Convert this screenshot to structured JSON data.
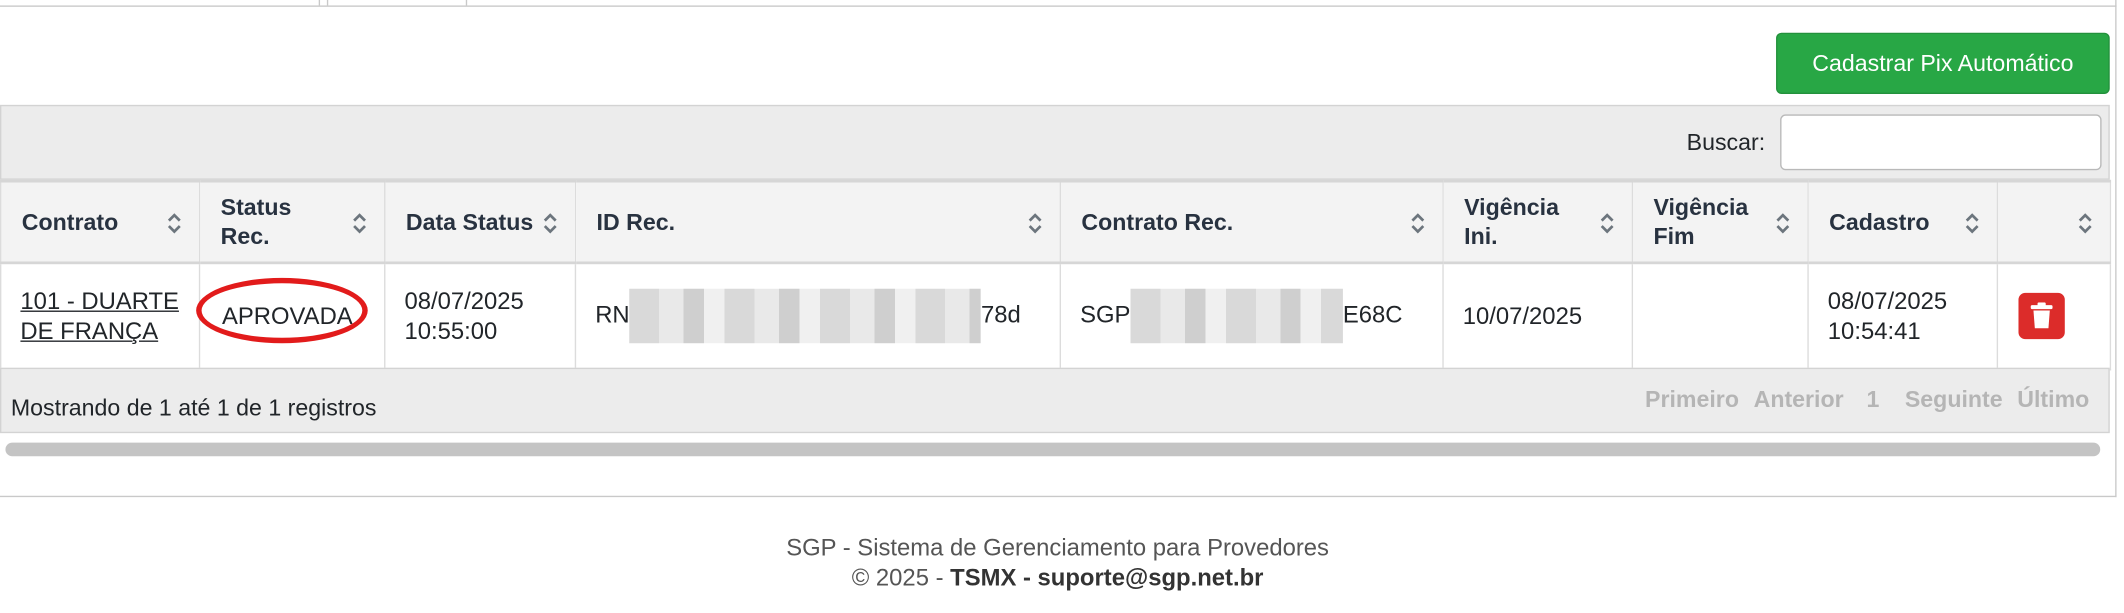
{
  "actions": {
    "add_pix_label": "Cadastrar Pix Automático"
  },
  "search": {
    "label": "Buscar:",
    "value": ""
  },
  "table": {
    "headers": [
      "Contrato",
      "Status Rec.",
      "Data Status",
      "ID Rec.",
      "Contrato Rec.",
      "Vigência Ini.",
      "Vigência Fim",
      "Cadastro",
      ""
    ],
    "rows": [
      {
        "contrato": "101 - DUARTE DE FRANÇA",
        "status": "APROVADA",
        "data_status": "08/07/2025 10:55:00",
        "id_rec_prefix": "RN",
        "id_rec_suffix": "78d",
        "contrato_rec_prefix": "SGP",
        "contrato_rec_suffix": "E68C",
        "vigencia_ini": "10/07/2025",
        "vigencia_fim": "",
        "cadastro": "08/07/2025 10:54:41"
      }
    ]
  },
  "info": {
    "text": "Mostrando de 1 até 1 de 1 registros"
  },
  "pagination": {
    "first": "Primeiro",
    "prev": "Anterior",
    "page": "1",
    "next": "Seguinte",
    "last": "Último"
  },
  "footer": {
    "line1": "SGP - Sistema de Gerenciamento para Provedores",
    "line2_prefix": "© 2025 -",
    "line2_bold": "TSMX - suporte@sgp.net.br"
  },
  "colors": {
    "primary_green": "#28a745",
    "danger_red": "#dc2c2a",
    "highlight_ring": "#e21b1b"
  }
}
